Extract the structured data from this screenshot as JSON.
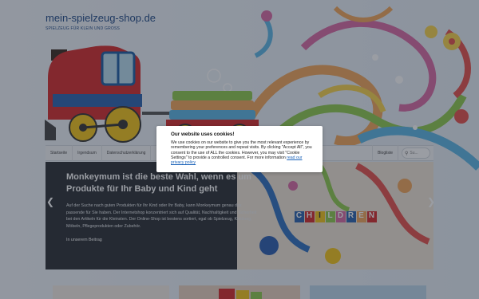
{
  "header": {
    "site_title": "mein-spielzeug-shop.de",
    "tagline": "SPIELZEUG FÜR KLEIN UND GROSS"
  },
  "nav": {
    "items": [
      {
        "label": "Startseite"
      },
      {
        "label": "Irgendsum"
      },
      {
        "label": "Datenschutzerklärung"
      }
    ],
    "trailing_item": "Blogliste",
    "search_placeholder": "Su..."
  },
  "slider": {
    "title": "Monkeymum ist die beste Wahl, wenn es um Produkte für Ihr Baby und Kind geht",
    "body": "Auf der Suche nach guten Produkten für Ihr Kind oder Ihr Baby, kann Monkeymum genau das passende für Sie haben. Der Internetshop konzentriert sich auf Qualität, Nachhaltigkeit und Sicherheit bei den Artikeln für die Kleinsten. Der Online-Shop ist bestens sortiert, egal ob Spielzeug, Kleidung, Möbeln, Pflegeprodukten oder Zubehör.",
    "link": "In unserem Beitrag",
    "art_letters": [
      "C",
      "H",
      "I",
      "L",
      "D",
      "R",
      "E",
      "N"
    ],
    "prev_icon": "chevron-left-icon",
    "next_icon": "chevron-right-icon"
  },
  "cookie": {
    "title": "Our website uses cookies!",
    "text": "We use cookies on our website to give you the most relevant experience by remembering your preferences and repeat visits. By clicking \"Accept All\", you consent to the use of ALL the cookies. However, you may visit \"Cookie Settings\" to provide a controlled consent. For more information",
    "link": "read our privacy policy"
  },
  "colors": {
    "title_blue": "#1f4a88",
    "slider_bg": "#2b2f34",
    "overlay": "rgba(30,38,50,0.45)",
    "link_blue": "#1a62b8"
  }
}
